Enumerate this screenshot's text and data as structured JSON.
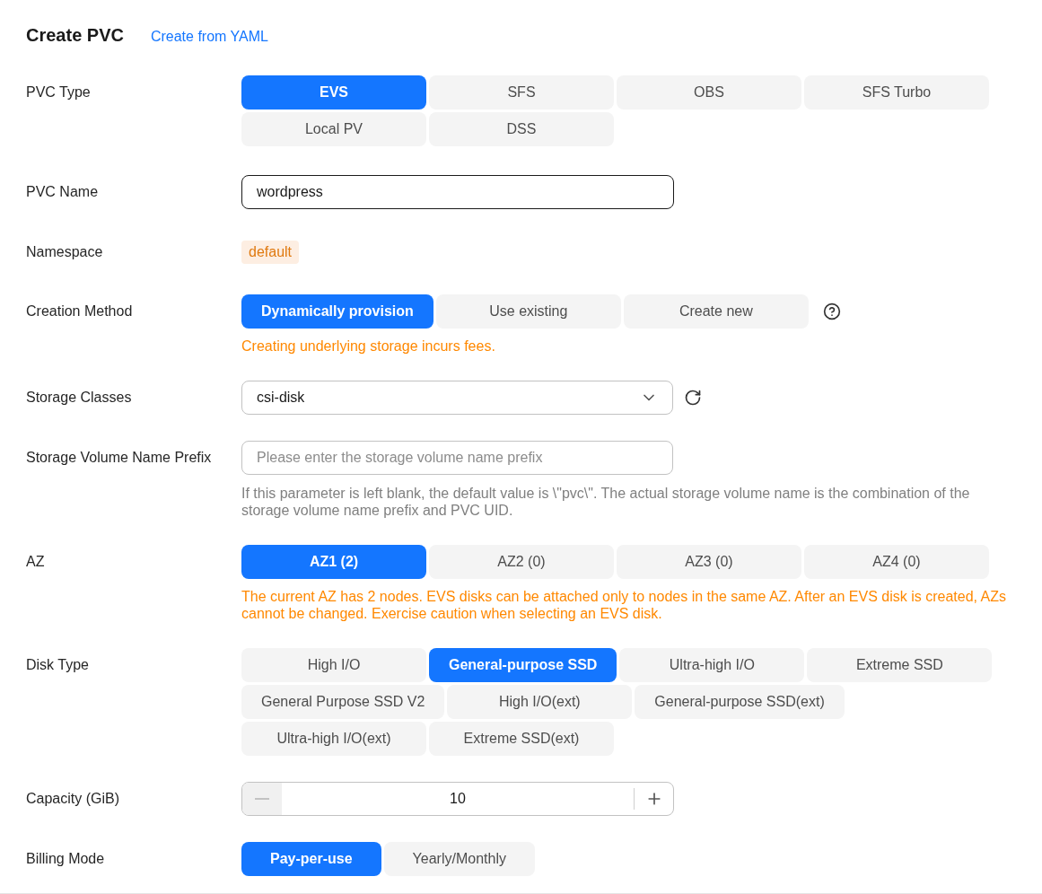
{
  "title": "Create PVC",
  "yaml_link": "Create from YAML",
  "fields": [
    {
      "kind": "options",
      "label": "PVC Type",
      "options": [
        {
          "label": "EVS",
          "selected": true
        },
        {
          "label": "SFS",
          "selected": false
        },
        {
          "label": "OBS",
          "selected": false
        },
        {
          "label": "SFS Turbo",
          "selected": false
        },
        {
          "label": "Local PV",
          "selected": false
        },
        {
          "label": "DSS",
          "selected": false
        }
      ]
    },
    {
      "kind": "text",
      "label": "PVC Name",
      "value": "wordpress"
    },
    {
      "kind": "badge",
      "label": "Namespace",
      "value": "default"
    },
    {
      "kind": "options",
      "label": "Creation Method",
      "options": [
        {
          "label": "Dynamically provision",
          "selected": true
        },
        {
          "label": "Use existing",
          "selected": false
        },
        {
          "label": "Create new",
          "selected": false
        }
      ],
      "help": true,
      "warning": "Creating underlying storage incurs fees."
    },
    {
      "kind": "select",
      "label": "Storage Classes",
      "value": "csi-disk",
      "refresh": true
    },
    {
      "kind": "input",
      "label": "Storage Volume Name Prefix",
      "placeholder": "Please enter the storage volume name prefix",
      "hint": "If this parameter is left blank, the default value is \\\"pvc\\\". The actual storage volume name is the combination of the storage volume name prefix and PVC UID."
    },
    {
      "kind": "options",
      "label": "AZ",
      "options": [
        {
          "label": "AZ1 (2)",
          "selected": true
        },
        {
          "label": "AZ2 (0)",
          "selected": false
        },
        {
          "label": "AZ3 (0)",
          "selected": false
        },
        {
          "label": "AZ4 (0)",
          "selected": false
        }
      ],
      "warning": "The current AZ has 2 nodes. EVS disks can be attached only to nodes in the same AZ. After an EVS disk is created, AZs cannot be changed. Exercise caution when selecting an EVS disk."
    },
    {
      "kind": "options",
      "label": "Disk Type",
      "options": [
        {
          "label": "High I/O",
          "selected": false
        },
        {
          "label": "General-purpose SSD",
          "selected": true
        },
        {
          "label": "Ultra-high I/O",
          "selected": false
        },
        {
          "label": "Extreme SSD",
          "selected": false
        },
        {
          "label": "General Purpose SSD V2",
          "selected": false
        },
        {
          "label": "High I/O(ext)",
          "selected": false
        },
        {
          "label": "General-purpose SSD(ext)",
          "selected": false
        },
        {
          "label": "Ultra-high I/O(ext)",
          "selected": false
        },
        {
          "label": "Extreme SSD(ext)",
          "selected": false
        }
      ]
    },
    {
      "kind": "stepper",
      "label": "Capacity (GiB)",
      "value": "10",
      "minus_disabled": true
    },
    {
      "kind": "options",
      "label": "Billing Mode",
      "options": [
        {
          "label": "Pay-per-use",
          "selected": true
        },
        {
          "label": "Yearly/Monthly",
          "selected": false
        }
      ]
    }
  ]
}
